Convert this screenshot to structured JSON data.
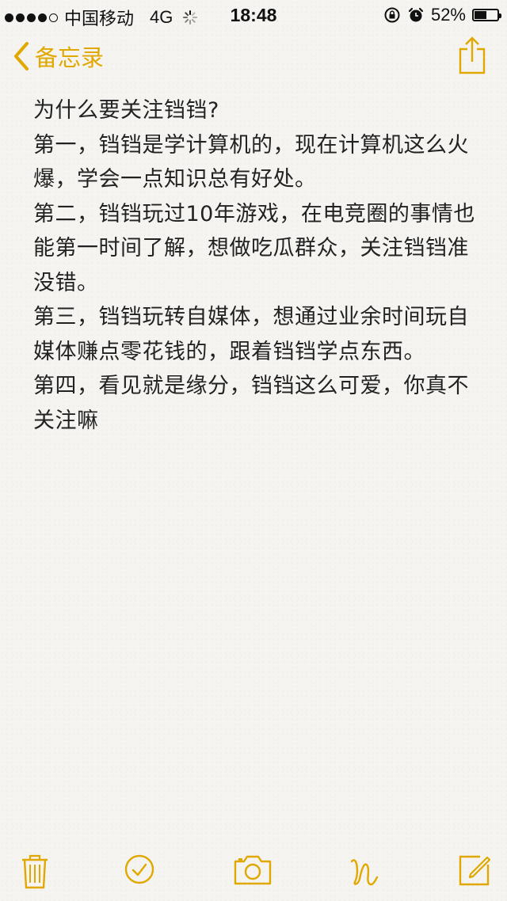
{
  "status_bar": {
    "carrier": "中国移动",
    "network": "4G",
    "time": "18:48",
    "battery_percent": "52%",
    "battery_level": 0.52
  },
  "nav": {
    "back_label": "备忘录"
  },
  "note": {
    "paragraphs": [
      "为什么要关注铛铛?",
      "第一，铛铛是学计算机的，现在计算机这么火爆，学会一点知识总有好处。",
      "第二，铛铛玩过10年游戏，在电竞圈的事情也能第一时间了解，想做吃瓜群众，关注铛铛准没错。",
      "第三，铛铛玩转自媒体，想通过业余时间玩自媒体赚点零花钱的，跟着铛铛学点东西。",
      "第四，看见就是缘分，铛铛这么可爱，你真不关注嘛"
    ]
  },
  "toolbar": {
    "icons": [
      "trash-icon",
      "checklist-icon",
      "camera-icon",
      "sketch-icon",
      "compose-icon"
    ]
  },
  "colors": {
    "accent": "#e0a800",
    "text": "#222222",
    "background": "#f5f4f0"
  }
}
